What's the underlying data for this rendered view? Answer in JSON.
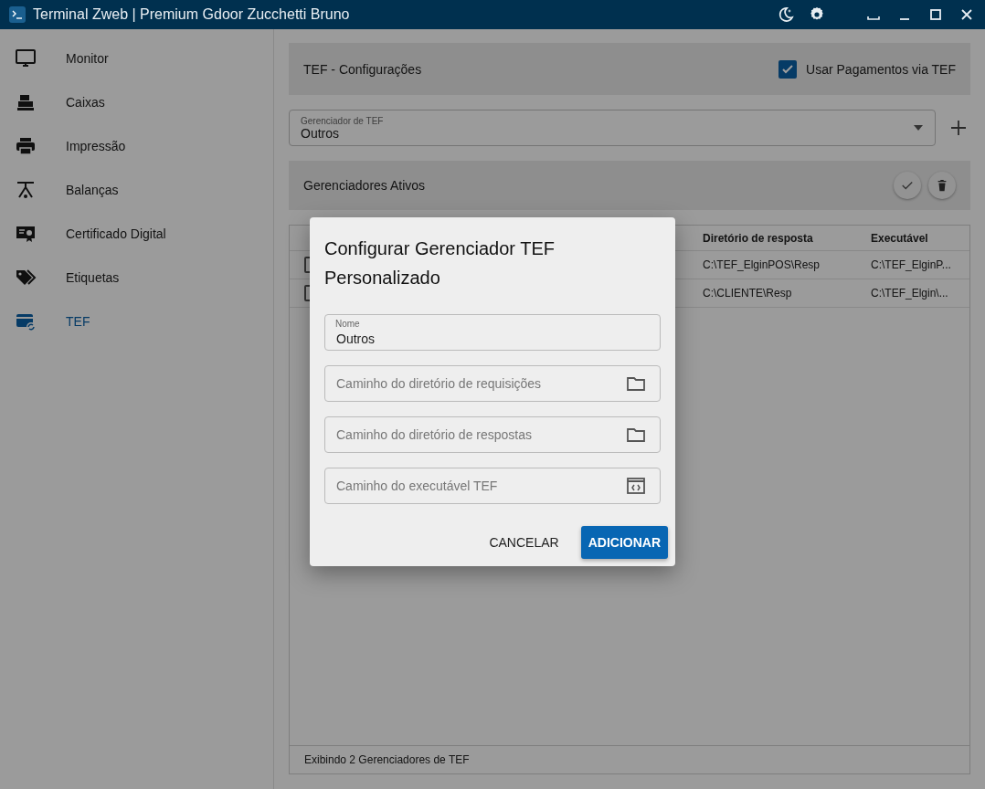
{
  "window": {
    "title": "Terminal Zweb | Premium Gdoor Zucchetti Bruno"
  },
  "sidebar": {
    "items": [
      {
        "label": "Monitor",
        "selected": false
      },
      {
        "label": "Caixas",
        "selected": false
      },
      {
        "label": "Impressão",
        "selected": false
      },
      {
        "label": "Balanças",
        "selected": false
      },
      {
        "label": "Certificado Digital",
        "selected": false
      },
      {
        "label": "Etiquetas",
        "selected": false
      },
      {
        "label": "TEF",
        "selected": true
      }
    ]
  },
  "header": {
    "title": "TEF - Configurações",
    "checkbox": {
      "label": "Usar Pagamentos via TEF",
      "checked": true
    }
  },
  "manager_select": {
    "label": "Gerenciador de TEF",
    "value": "Outros"
  },
  "active_panel": {
    "title": "Gerenciadores Ativos"
  },
  "table": {
    "columns": [
      "Diretório de resposta",
      "Executável"
    ],
    "rows": [
      {
        "checked": false,
        "cells": [
          "C:\\TEF_ElginPOS\\Resp",
          "C:\\TEF_ElginP..."
        ]
      },
      {
        "checked": false,
        "cells": [
          "C:\\CLIENTE\\Resp",
          "C:\\TEF_Elgin\\..."
        ]
      }
    ],
    "footer": "Exibindo 2 Gerenciadores de TEF"
  },
  "dialog": {
    "title": "Configurar Gerenciador TEF Personalizado",
    "fields": [
      {
        "kind": "text",
        "label": "Nome",
        "value": "Outros"
      },
      {
        "kind": "folder",
        "placeholder": "Caminho do diretório de requisições"
      },
      {
        "kind": "folder",
        "placeholder": "Caminho do diretório de respostas"
      },
      {
        "kind": "executable",
        "placeholder": "Caminho do executável TEF"
      }
    ],
    "buttons": [
      {
        "label": "CANCELAR",
        "kind": "text"
      },
      {
        "label": "ADICIONAR",
        "kind": "primary"
      }
    ]
  }
}
